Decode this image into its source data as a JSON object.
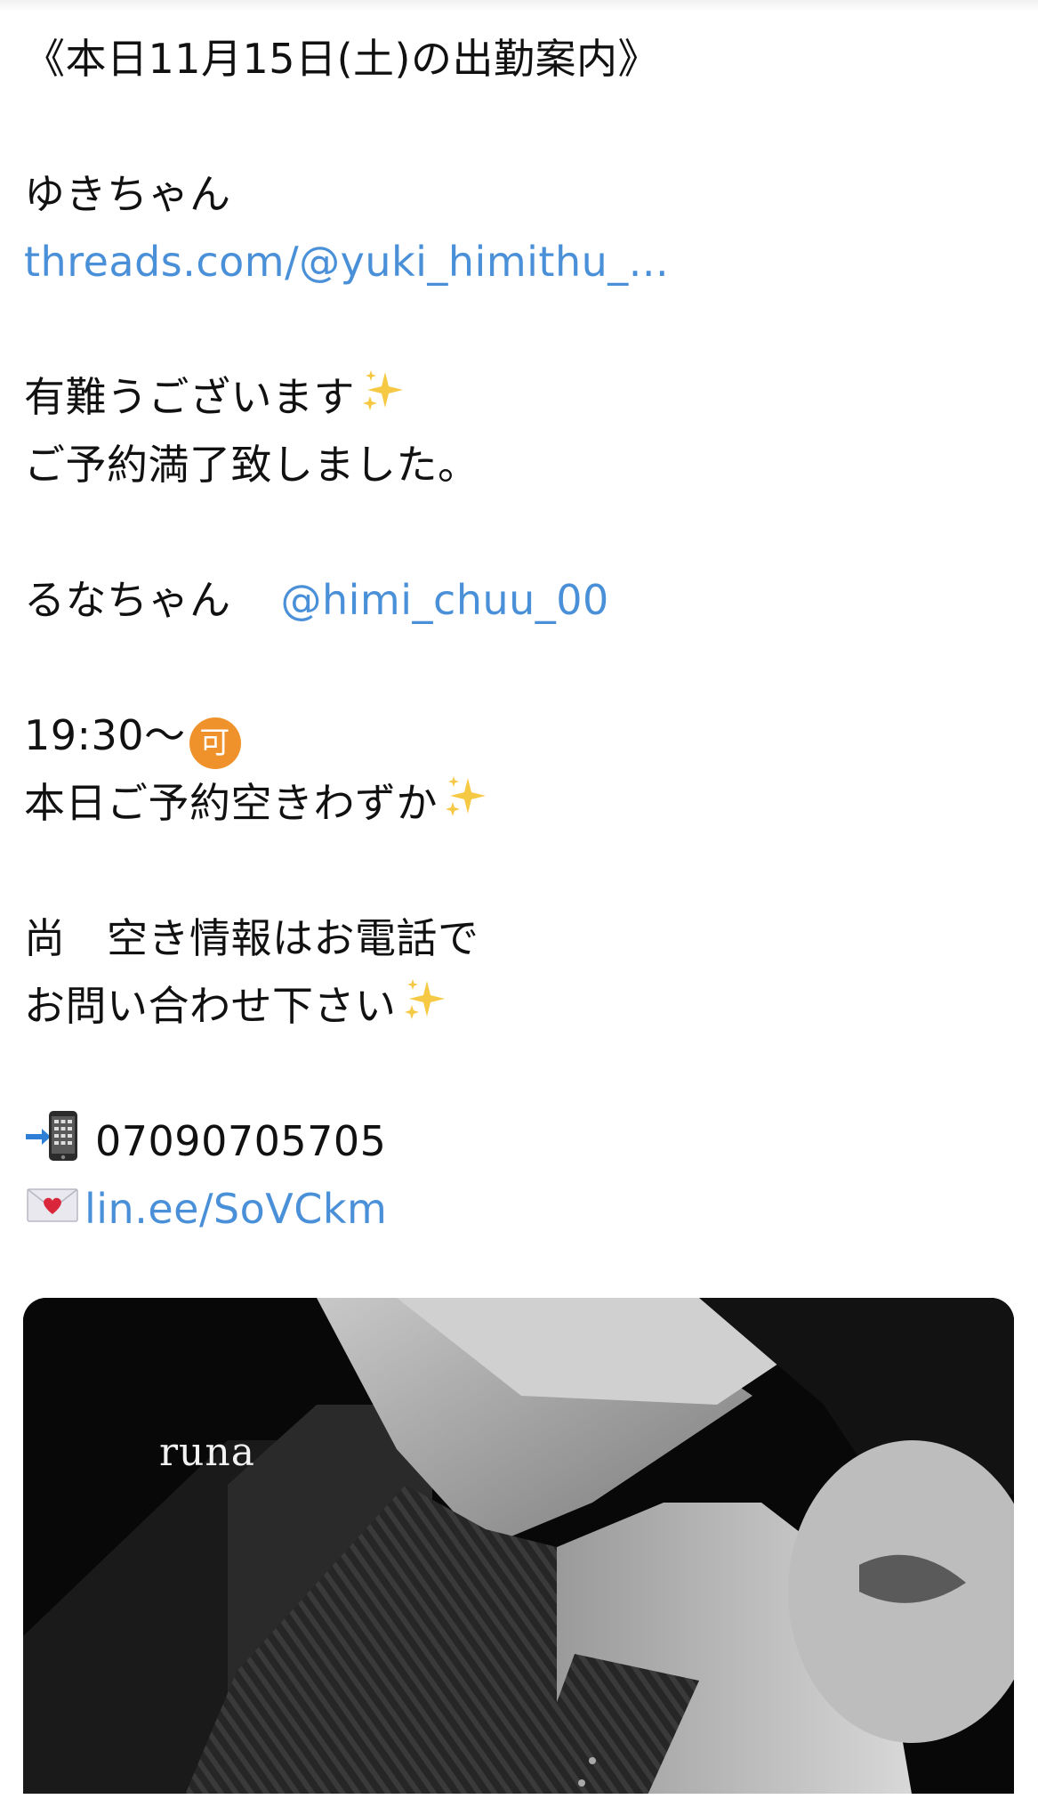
{
  "post": {
    "heading": "《本日11月15日(土)の出勤案内》",
    "yuki": {
      "name": "ゆきちゃん",
      "link": "threads.com/@yuki_himithu_..."
    },
    "thanks": "有難うございます",
    "full": "ご予約満了致しました。",
    "runa": {
      "name": "るなちゃん",
      "handle": "@himi_chuu_00"
    },
    "time": "19:30〜",
    "available_badge": "可",
    "few_slots": "本日ご予約空きわずか",
    "note_line1": "尚　空き情報はお電話で",
    "note_line2": "お問い合わせ下さい",
    "phone": "07090705705",
    "line_link": "lin.ee/SoVCkm"
  },
  "media": {
    "label": "runa"
  },
  "icons": {
    "sparkles": "sparkles-icon",
    "phone": "mobile-phone-arrow-icon",
    "mail": "love-letter-icon",
    "available": "japanese-acceptable-button-icon"
  },
  "colors": {
    "link": "#4a90d9",
    "badge": "#f0922b",
    "text": "#111111"
  }
}
